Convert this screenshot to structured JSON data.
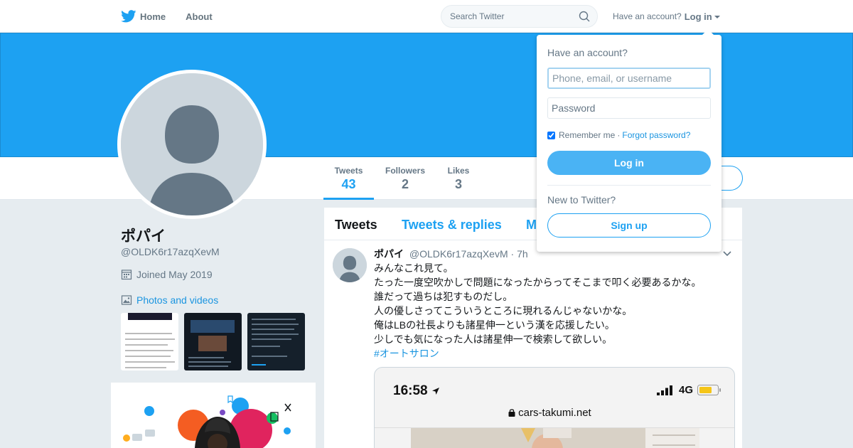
{
  "nav": {
    "home_label": "Home",
    "about_label": "About",
    "search_placeholder": "Search Twitter",
    "have_account_text": "Have an account?",
    "login_label": "Log in"
  },
  "profile": {
    "name": "ポパイ",
    "handle": "@OLDK6r17azqXevM",
    "joined": "Joined May 2019",
    "photos_label": "Photos and videos"
  },
  "stats": [
    {
      "label": "Tweets",
      "value": "43"
    },
    {
      "label": "Followers",
      "value": "2"
    },
    {
      "label": "Likes",
      "value": "3"
    }
  ],
  "tabs": [
    {
      "label": "Tweets"
    },
    {
      "label": "Tweets & replies"
    },
    {
      "label": "M"
    }
  ],
  "tweet": {
    "name": "ポパイ",
    "handle": "@OLDK6r17azqXevM",
    "dot": "·",
    "time": "7h",
    "lines": [
      "みんなこれ見て。",
      "たった一度空吹かしで問題になったからってそこまで叩く必要あるかな。",
      "誰だって過ちは犯すものだし。",
      "人の優しさってこういうところに現れるんじゃないかな。",
      "俺はLBの社長よりも諸星伸一という漢を応援したい。",
      "少しでも気になった人は諸星伸一で検索して欲しい。"
    ],
    "hashtag": "#オートサロン",
    "media": {
      "clock": "16:58",
      "network": "4G",
      "url": "cars-takumi.net"
    }
  },
  "login_dropdown": {
    "title": "Have an account?",
    "username_placeholder": "Phone, email, or username",
    "password_placeholder": "Password",
    "remember_label": "Remember me",
    "separator": "·",
    "forgot_label": "Forgot password?",
    "login_button": "Log in",
    "new_text": "New to Twitter?",
    "signup_button": "Sign up"
  },
  "colors": {
    "brand": "#1da1f2",
    "link": "#1b95e0",
    "muted": "#657786",
    "background": "#e6ecf0"
  },
  "icons": [
    "twitter-bird-icon",
    "home-icon",
    "search-icon",
    "caret-down-icon",
    "calendar-icon",
    "photo-icon",
    "chevron-down-icon",
    "location-arrow-icon",
    "lock-icon",
    "battery-icon"
  ]
}
